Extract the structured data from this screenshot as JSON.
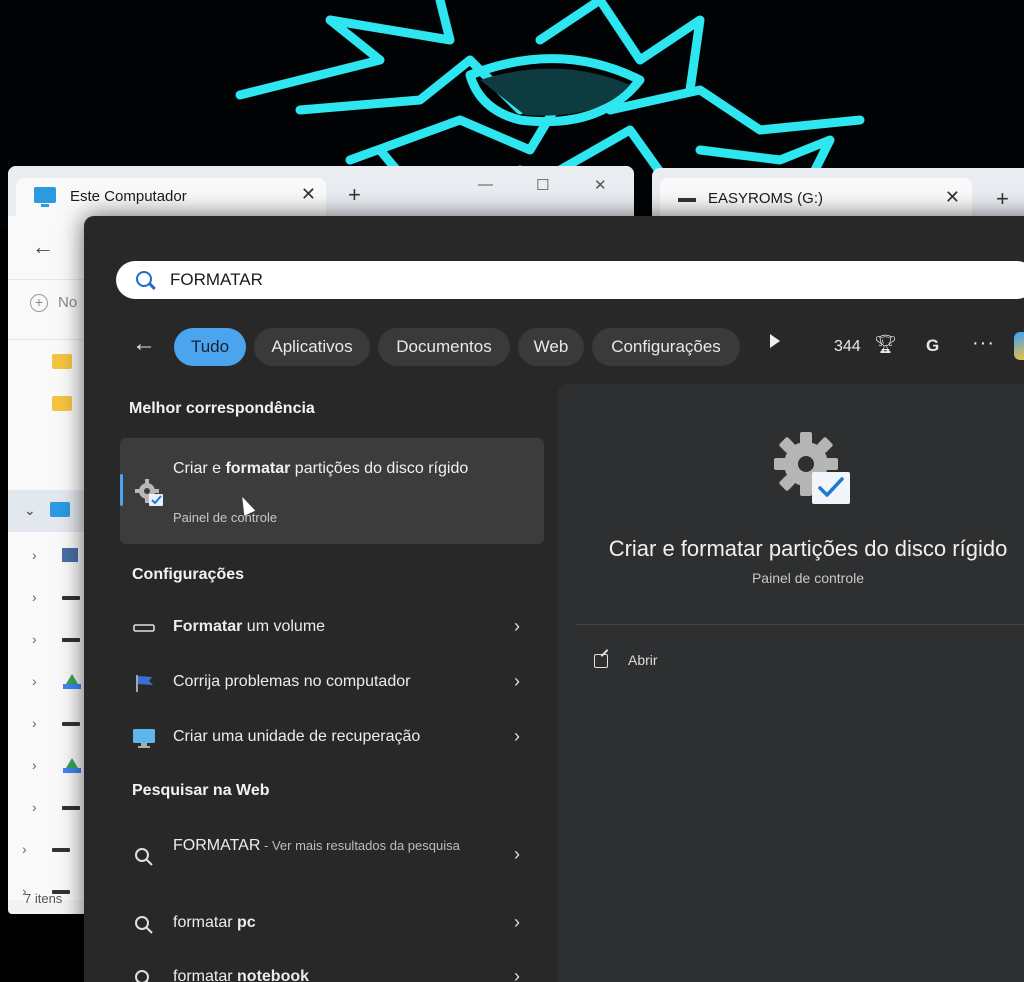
{
  "explorer": {
    "tab_title": "Este Computador",
    "close_glyph": "✕",
    "new_tab_glyph": "+",
    "new_button_label": "No",
    "status_text": "7 itens"
  },
  "easyroms": {
    "tab_title": "EASYROMS (G:)",
    "close_glyph": "✕",
    "new_tab_glyph": "+"
  },
  "search": {
    "query": "FORMATAR",
    "filters": [
      "Tudo",
      "Aplicativos",
      "Documentos",
      "Web",
      "Configurações"
    ],
    "active_filter": "Tudo",
    "points": "344",
    "account_initial": "G",
    "more_glyph": "···"
  },
  "results": {
    "best_header": "Melhor correspondência",
    "best_title_pre": "Criar e ",
    "best_title_bold": "formatar",
    "best_title_post": " partições do disco rígido",
    "best_sub": "Painel de controle",
    "settings_header": "Configurações",
    "settings": [
      {
        "bold": "Formatar",
        "rest": " um volume",
        "icon": "drive-icon"
      },
      {
        "bold": "",
        "rest": "Corrija problemas no computador",
        "icon": "flag-icon"
      },
      {
        "bold": "",
        "rest": "Criar uma unidade de recuperação",
        "icon": "monitor-icon"
      }
    ],
    "web_header": "Pesquisar na Web",
    "web": [
      {
        "main": "FORMATAR",
        "dim": " - Ver mais resultados da pesquisa"
      },
      {
        "main": "formatar ",
        "bold": "pc"
      },
      {
        "main": "formatar ",
        "bold": "notebook"
      }
    ]
  },
  "preview": {
    "title": "Criar e formatar partições do disco rígido",
    "subtitle": "Painel de controle",
    "open_label": "Abrir"
  },
  "colors": {
    "accent": "#4ca4ef",
    "panel_bg": "#282828",
    "wallpaper_cyan": "#2ee6f0"
  }
}
